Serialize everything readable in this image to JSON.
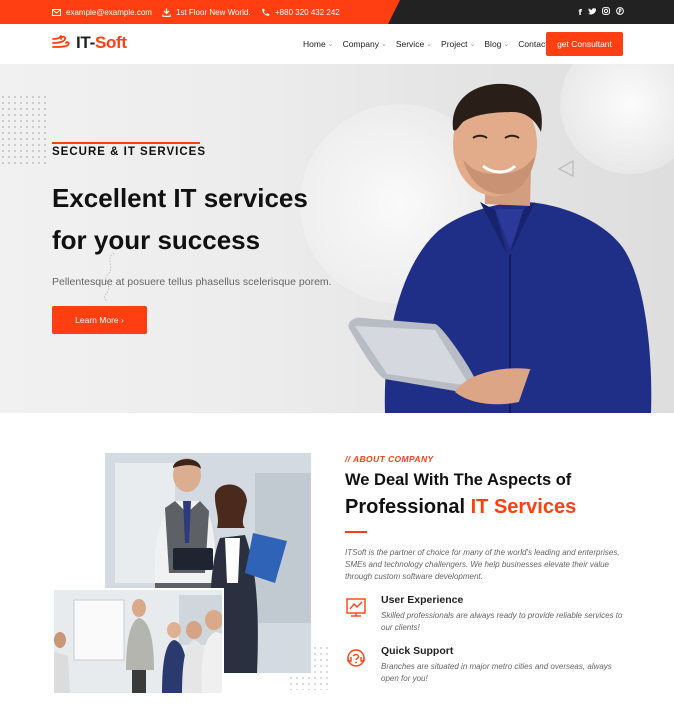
{
  "topbar": {
    "email": "example@example.com",
    "address": "1st Floor New World.",
    "phone": "+880 320 432 242",
    "social": [
      {
        "icon": "facebook-icon",
        "glyph": "f"
      },
      {
        "icon": "twitter-icon",
        "glyph": "t"
      },
      {
        "icon": "instagram-icon",
        "glyph": "◎"
      },
      {
        "icon": "pinterest-icon",
        "glyph": "℗"
      }
    ]
  },
  "header": {
    "logo_part1": "IT-",
    "logo_part2": "Soft",
    "nav": [
      "Home",
      "Company",
      "Service",
      "Project",
      "Blog",
      "Contact"
    ],
    "cta": "get Consultant"
  },
  "hero": {
    "subtitle": "SECURE & IT SERVICES",
    "title_line1": "Excellent IT services",
    "title_line2": "for your success",
    "description": "Pellentesque at posuere tellus phasellus scelerisque porem.",
    "button": "Learn More ›"
  },
  "about": {
    "tag": "// ABOUT COMPANY",
    "heading_line1": "We Deal With The Aspects of",
    "heading_line2_plain": "Professional ",
    "heading_line2_accent": "IT Services",
    "description": "ITSoft is the partner of choice for many of the world's leading and enterprises, SMEs and technology challengers. We help businesses elevate their value through custom software development.",
    "features": [
      {
        "title": "User Experience",
        "text": "Skilled professionals are always ready to provide reliable services to our clients!"
      },
      {
        "title": "Quick Support",
        "text": "Branches are situated in major metro cities and overseas, always open for you!"
      }
    ]
  },
  "colors": {
    "accent": "#ff3f12",
    "dark": "#222222"
  }
}
